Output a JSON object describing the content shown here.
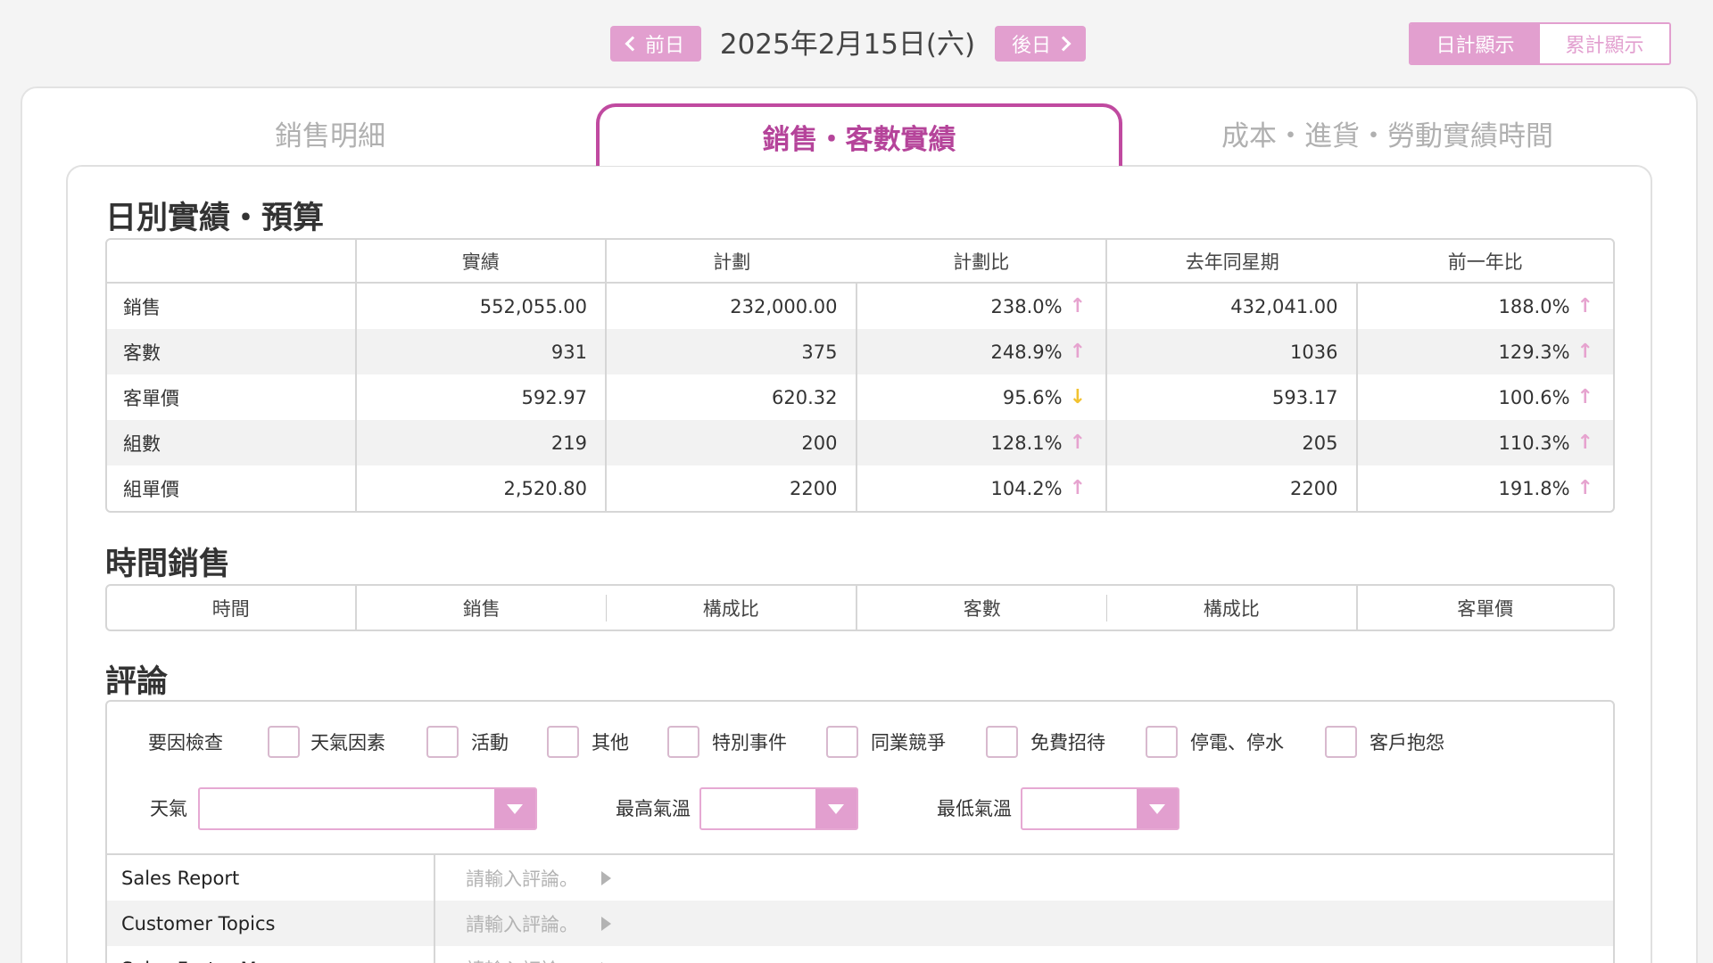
{
  "header": {
    "prev_label": "前日",
    "date": "2025年2月15日(六)",
    "next_label": "後日",
    "toggle_daily": "日計顯示",
    "toggle_cumulative": "累計顯示"
  },
  "tabs": {
    "detail": "銷售明細",
    "active": "銷售・客數實績",
    "cost": "成本・進貨・勞動實績時間"
  },
  "daily": {
    "title": "日別實績・預算",
    "columns": [
      "實績",
      "計劃",
      "計劃比",
      "去年同星期",
      "前一年比"
    ],
    "rows": [
      {
        "label": "銷售",
        "actual": "552,055.00",
        "plan": "232,000.00",
        "plan_ratio": "238.0%",
        "plan_dir": "↑",
        "last_year": "432,041.00",
        "yoy": "188.0%",
        "yoy_dir": "↑"
      },
      {
        "label": "客數",
        "actual": "931",
        "plan": "375",
        "plan_ratio": "248.9%",
        "plan_dir": "↑",
        "last_year": "1036",
        "yoy": "129.3%",
        "yoy_dir": "↑"
      },
      {
        "label": "客單價",
        "actual": "592.97",
        "plan": "620.32",
        "plan_ratio": "95.6%",
        "plan_dir": "↓",
        "last_year": "593.17",
        "yoy": "100.6%",
        "yoy_dir": "↑"
      },
      {
        "label": "組數",
        "actual": "219",
        "plan": "200",
        "plan_ratio": "128.1%",
        "plan_dir": "↑",
        "last_year": "205",
        "yoy": "110.3%",
        "yoy_dir": "↑"
      },
      {
        "label": "組單價",
        "actual": "2,520.80",
        "plan": "2200",
        "plan_ratio": "104.2%",
        "plan_dir": "↑",
        "last_year": "2200",
        "yoy": "191.8%",
        "yoy_dir": "↑"
      }
    ]
  },
  "hourly": {
    "title": "時間銷售",
    "columns": [
      "時間",
      "銷售",
      "構成比",
      "客數",
      "構成比",
      "客單價"
    ]
  },
  "comments": {
    "title": "評論",
    "factor_label": "要因檢查",
    "factors": [
      "天氣因素",
      "活動",
      "其他",
      "特別事件",
      "同業競爭",
      "免費招待",
      "停電、停水",
      "客戶抱怨"
    ],
    "weather_label": "天氣",
    "high_temp_label": "最高氣溫",
    "low_temp_label": "最低氣溫",
    "placeholder": "請輸入評論。",
    "rows": [
      "Sales Report",
      "Customer Topics",
      "Sales Factor Memo"
    ]
  },
  "colors": {
    "accent": "#e29fcf",
    "active_tab": "#b5449a",
    "arrow_up": "#e6a3cf",
    "arrow_down": "#f2c230"
  }
}
